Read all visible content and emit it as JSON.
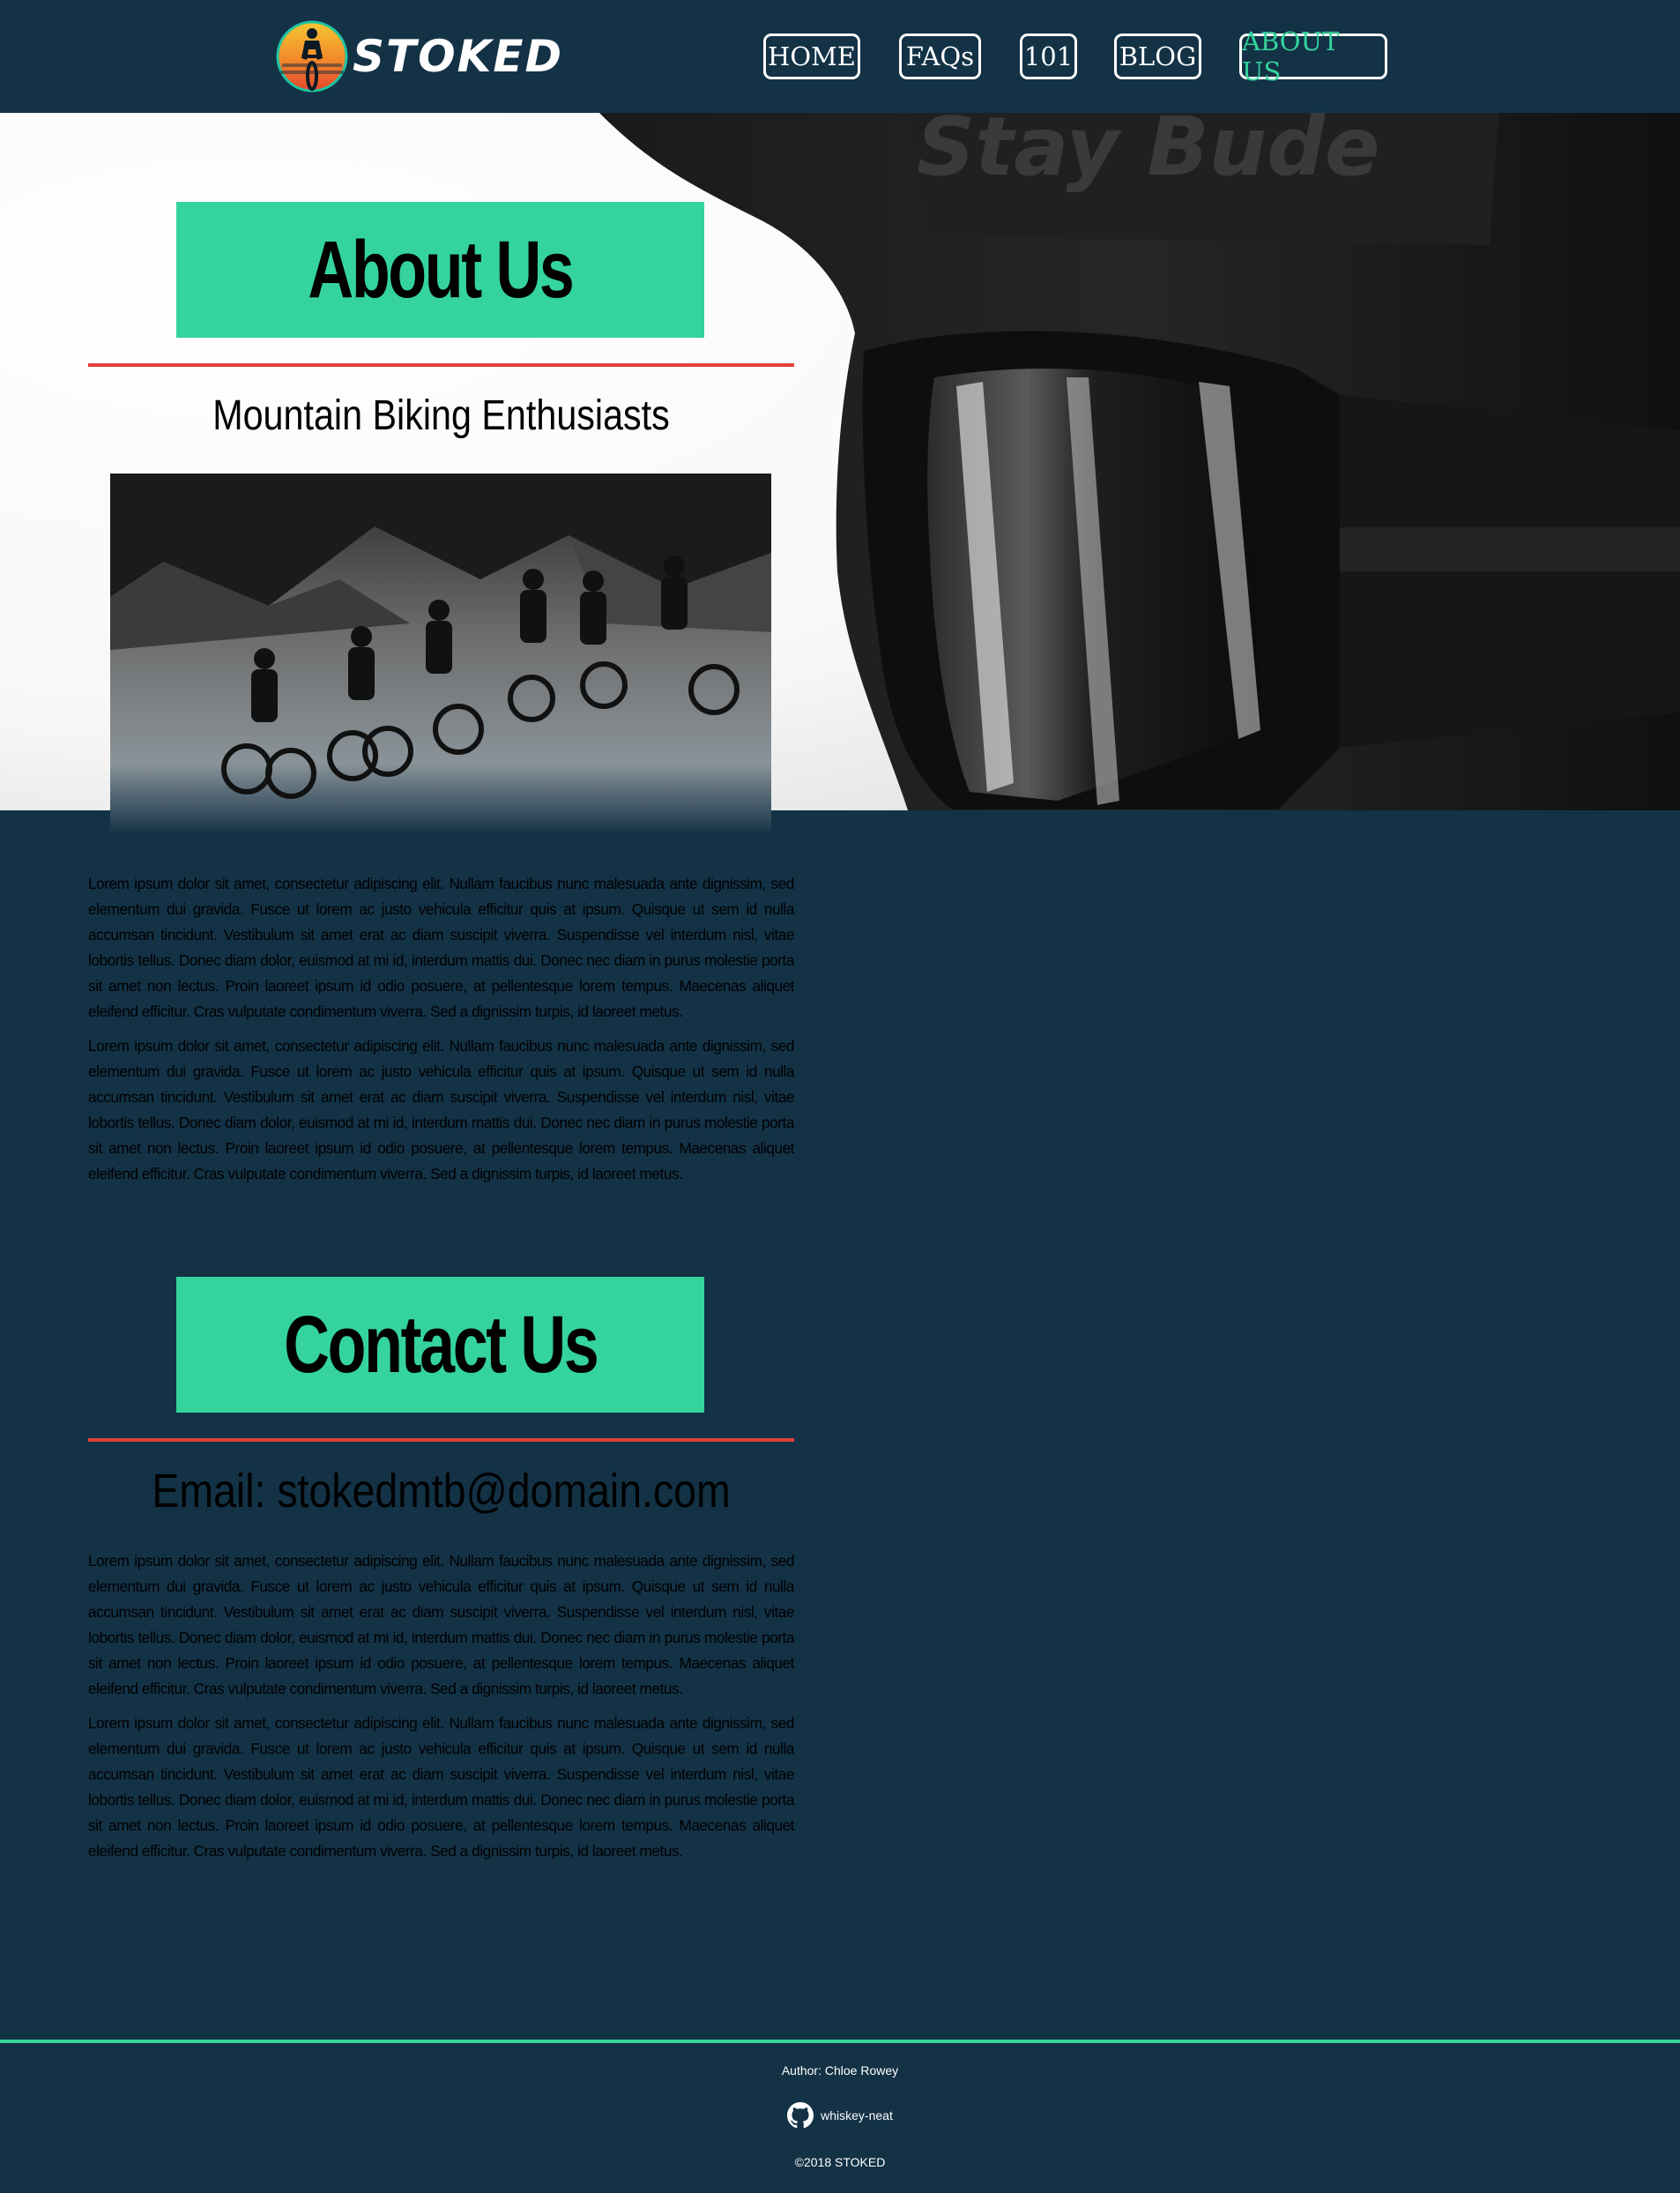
{
  "brand": {
    "name": "STOKED",
    "logo_icon": "mountain-biker-sunset-logo"
  },
  "nav": {
    "items": [
      {
        "label": "HOME",
        "active": false
      },
      {
        "label": "FAQs",
        "active": false
      },
      {
        "label": "101",
        "active": false
      },
      {
        "label": "BLOG",
        "active": false
      },
      {
        "label": "ABOUT US",
        "active": true
      }
    ]
  },
  "hero": {
    "background_image": "black-and-white-helmet-goggles-photo",
    "helmet_lettering": "Stay Bude"
  },
  "about": {
    "heading": "About Us",
    "subheading": "Mountain Biking Enthusiasts",
    "photo": "team-of-mountain-bikers-photo",
    "paragraphs": [
      "Lorem ipsum dolor sit amet, consectetur adipiscing elit. Nullam faucibus nunc malesuada ante dignissim, sed elementum dui gravida. Fusce ut lorem ac justo vehicula efficitur quis at ipsum. Quisque ut sem id nulla accumsan tincidunt. Vestibulum sit amet erat ac diam suscipit viverra. Suspendisse vel interdum nisl, vitae lobortis tellus. Donec diam dolor, euismod at mi id, interdum mattis dui. Donec nec diam in purus molestie porta sit amet non lectus. Proin laoreet ipsum id odio posuere, at pellentesque lorem tempus. Maecenas aliquet eleifend efficitur. Cras vulputate condimentum viverra. Sed a dignissim turpis, id laoreet metus.",
      "Lorem ipsum dolor sit amet, consectetur adipiscing elit. Nullam faucibus nunc malesuada ante dignissim, sed elementum dui gravida. Fusce ut lorem ac justo vehicula efficitur quis at ipsum. Quisque ut sem id nulla accumsan tincidunt. Vestibulum sit amet erat ac diam suscipit viverra. Suspendisse vel interdum nisl, vitae lobortis tellus. Donec diam dolor, euismod at mi id, interdum mattis dui. Donec nec diam in purus molestie porta sit amet non lectus. Proin laoreet ipsum id odio posuere, at pellentesque lorem tempus. Maecenas aliquet eleifend efficitur. Cras vulputate condimentum viverra. Sed a dignissim turpis, id laoreet metus."
    ]
  },
  "contact": {
    "heading": "Contact Us",
    "email_line": "Email: stokedmtb@domain.com",
    "paragraphs": [
      "Lorem ipsum dolor sit amet, consectetur adipiscing elit. Nullam faucibus nunc malesuada ante dignissim, sed elementum dui gravida. Fusce ut lorem ac justo vehicula efficitur quis at ipsum. Quisque ut sem id nulla accumsan tincidunt. Vestibulum sit amet erat ac diam suscipit viverra. Suspendisse vel interdum nisl, vitae lobortis tellus. Donec diam dolor, euismod at mi id, interdum mattis dui. Donec nec diam in purus molestie porta sit amet non lectus. Proin laoreet ipsum id odio posuere, at pellentesque lorem tempus. Maecenas aliquet eleifend efficitur. Cras vulputate condimentum viverra. Sed a dignissim turpis, id laoreet metus.",
      "Lorem ipsum dolor sit amet, consectetur adipiscing elit. Nullam faucibus nunc malesuada ante dignissim, sed elementum dui gravida. Fusce ut lorem ac justo vehicula efficitur quis at ipsum. Quisque ut sem id nulla accumsan tincidunt. Vestibulum sit amet erat ac diam suscipit viverra. Suspendisse vel interdum nisl, vitae lobortis tellus. Donec diam dolor, euismod at mi id, interdum mattis dui. Donec nec diam in purus molestie porta sit amet non lectus. Proin laoreet ipsum id odio posuere, at pellentesque lorem tempus. Maecenas aliquet eleifend efficitur. Cras vulputate condimentum viverra. Sed a dignissim turpis, id laoreet metus."
    ]
  },
  "footer": {
    "author": "Author: Chloe Rowey",
    "github_icon": "github-icon",
    "github_user": "whiskey-neat",
    "copyright": "©2018 STOKED"
  },
  "colors": {
    "navy": "#133246",
    "accent_green": "#34d49c",
    "rule_red": "#e0413a",
    "white": "#ffffff"
  }
}
